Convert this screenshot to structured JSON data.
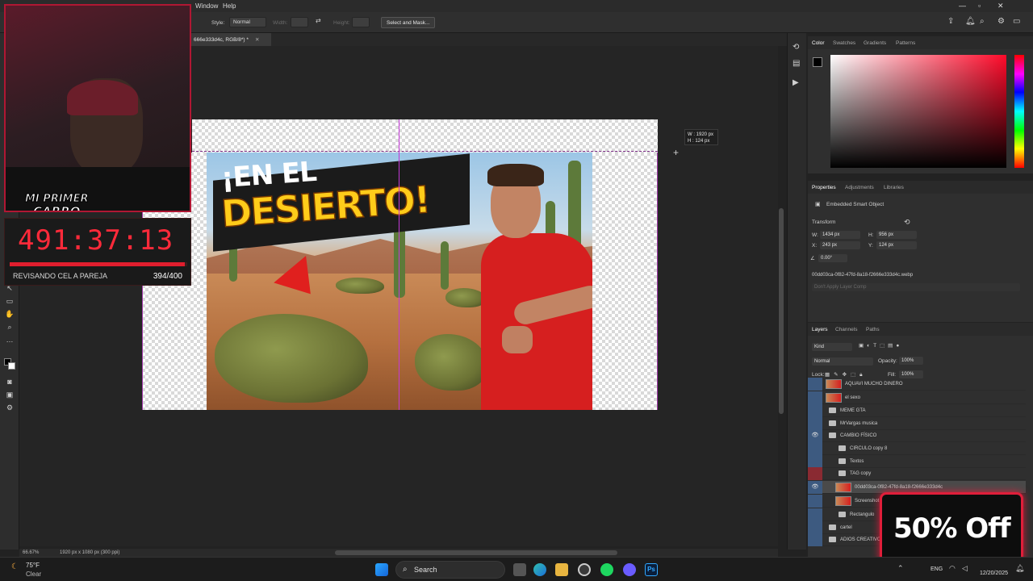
{
  "menu": {
    "window": "Window",
    "help": "Help"
  },
  "options": {
    "style_label": "Style:",
    "style_value": "Normal",
    "width_label": "Width:",
    "height_label": "Height:",
    "select_mask": "Select and Mask..."
  },
  "document_tab": "666e333d4c, RGB/8*) *",
  "canvas": {
    "size_tooltip_w": "W : 1920 px",
    "size_tooltip_h": "H :  124 px"
  },
  "thumbnail": {
    "title_line1": "¡EN EL",
    "title_line2": "DESIERTO!"
  },
  "stream_overlay": {
    "badge_line1": "MI PRIMER",
    "badge_line2": "CARRO",
    "timer": "491:37:13",
    "goal_label": "REVISANDO CEL A PAREJA",
    "goal_count": "394/400",
    "goal_progress": 0.985
  },
  "color_panel": {
    "tabs": [
      "Color",
      "Swatches",
      "Gradients",
      "Patterns"
    ],
    "foreground": "#000000",
    "background": "#ffffff"
  },
  "properties_panel": {
    "tabs": [
      "Properties",
      "Adjustments",
      "Libraries"
    ],
    "type": "Embedded Smart Object",
    "section": "Transform",
    "w": "W:",
    "w_val": "1434 px",
    "h": "H:",
    "h_val": "956 px",
    "x": "X:",
    "x_val": "243 px",
    "y": "Y:",
    "y_val": "124 px",
    "angle_val": "0.00°",
    "filename": "00dd03ca-0f82-47fd-8a18-f2666e333d4c.webp",
    "comps": "Don't Apply Layer Comp"
  },
  "layers_panel": {
    "tabs": [
      "Layers",
      "Channels",
      "Paths"
    ],
    "kind": "Kind",
    "blend": "Normal",
    "opacity_label": "Opacity:",
    "opacity": "100%",
    "lock_label": "Lock:",
    "fill_label": "Fill:",
    "fill": "100%",
    "layers": [
      {
        "name": "AQUAVI MUCHO DINERO",
        "type": "image"
      },
      {
        "name": "el sexo",
        "type": "image"
      },
      {
        "name": "MEME GTA",
        "type": "folder"
      },
      {
        "name": "MrVargas musica",
        "type": "folder"
      },
      {
        "name": "CAMBIO FÍSICO",
        "type": "folder"
      },
      {
        "name": "CIRCULO copy 8",
        "type": "folder"
      },
      {
        "name": "Textos",
        "type": "folder"
      },
      {
        "name": "TAG copy",
        "type": "folder"
      },
      {
        "name": "00dd03ca-0f82-47fd-8a18-f2666e333d4c",
        "type": "smart"
      },
      {
        "name": "Screenshot",
        "type": "image"
      },
      {
        "name": "Rectangulo",
        "type": "folder"
      },
      {
        "name": "cartel",
        "type": "folder"
      },
      {
        "name": "ADIOS CREATIVO",
        "type": "folder"
      }
    ]
  },
  "promo": {
    "text": "50% Off"
  },
  "statusbar": {
    "zoom": "66.67%",
    "doc_info": "1920 px x 1080 px (300 ppi)"
  },
  "taskbar": {
    "weather_temp": "75°F",
    "weather_desc": "Clear",
    "search": "Search",
    "lang": "ENG",
    "date": "12/20/2025"
  },
  "colors": {
    "accent_red": "#e01e3a",
    "timer_red": "#ff2a3a"
  }
}
